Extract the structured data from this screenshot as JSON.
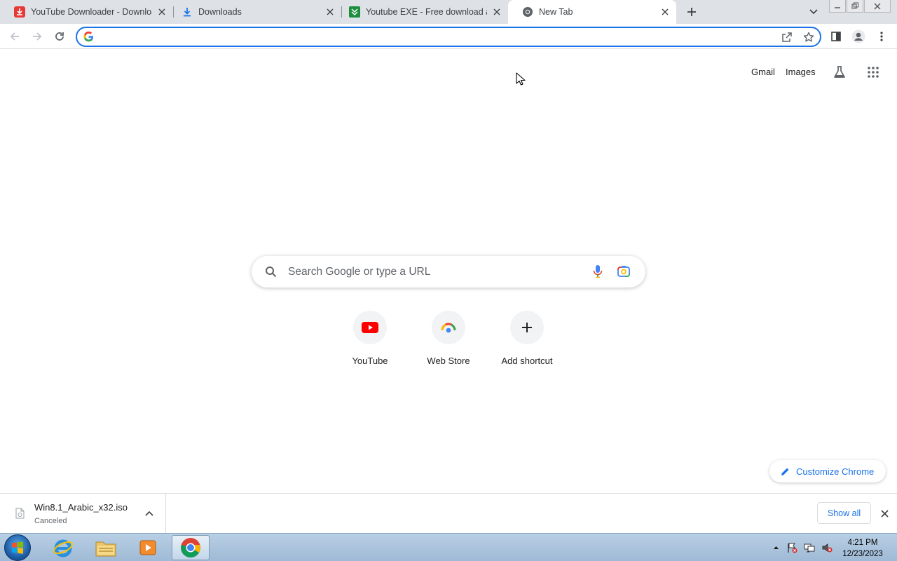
{
  "browser": {
    "tabs": [
      {
        "title": "YouTube Downloader - Download",
        "icon": "youtube-downloader-favicon",
        "active": false
      },
      {
        "title": "Downloads",
        "icon": "download-favicon",
        "active": false
      },
      {
        "title": "Youtube EXE - Free download and",
        "icon": "softonic-favicon",
        "active": false
      },
      {
        "title": "New Tab",
        "icon": "chrome-favicon",
        "active": true
      }
    ],
    "omnibox": {
      "value": "",
      "placeholder": ""
    },
    "accent_color": "#1a73e8"
  },
  "ntp": {
    "links": {
      "gmail": "Gmail",
      "images": "Images"
    },
    "search_placeholder": "Search Google or type a URL",
    "shortcuts": [
      {
        "label": "YouTube",
        "icon": "youtube-icon"
      },
      {
        "label": "Web Store",
        "icon": "web-store-icon"
      },
      {
        "label": "Add shortcut",
        "icon": "plus-icon"
      }
    ],
    "customize_label": "Customize Chrome"
  },
  "downloads": {
    "item": {
      "filename": "Win8.1_Arabic_x32.iso",
      "status": "Canceled"
    },
    "show_all_label": "Show all"
  },
  "taskbar": {
    "apps": [
      "internet-explorer-icon",
      "file-explorer-icon",
      "media-player-icon",
      "chrome-icon"
    ],
    "clock": {
      "time": "4:21 PM",
      "date": "12/23/2023"
    }
  }
}
